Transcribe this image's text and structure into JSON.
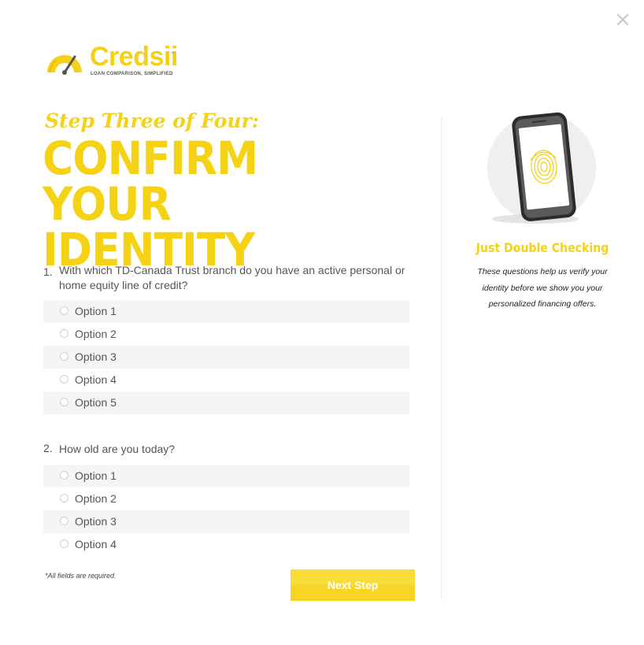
{
  "modal": {
    "close_label": "×"
  },
  "logo": {
    "brand": "Credsii",
    "trademark": "™",
    "tagline": "LOAN COMPARISON, SIMPLIFIED",
    "colors": {
      "brand": "#f5cf1a",
      "dial": "#555555"
    }
  },
  "header": {
    "step": "Step Three of Four:",
    "headline": "CONFIRM YOUR IDENTITY"
  },
  "questions": [
    {
      "number": "1.",
      "text": "With which TD-Canada Trust branch do you have an active personal or home equity line of credit?",
      "options": [
        "Option 1",
        "Option 2",
        "Option 3",
        "Option 4",
        "Option 5"
      ]
    },
    {
      "number": "2.",
      "text": "How old are you today?",
      "options": [
        "Option 1",
        "Option 2",
        "Option 3",
        "Option 4"
      ]
    }
  ],
  "footer": {
    "required_note": "*All fields are required.",
    "next_label": "Next Step"
  },
  "sidebar": {
    "icon": "fingerprint-phone-icon",
    "title": "Just Double Checking",
    "text": "These questions help us verify your identity before we show you your personalized financing offers."
  },
  "colors": {
    "accent": "#f5d214",
    "button": "#f6d623",
    "option_shade": "#f5f5f5"
  }
}
